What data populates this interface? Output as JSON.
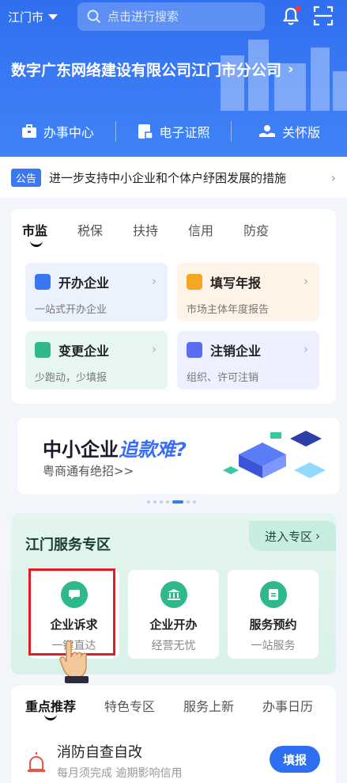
{
  "header": {
    "city": "江门市",
    "search_placeholder": "点击进行搜索",
    "company": "数字广东网络建设有限公司江门市分公司",
    "quick": [
      "办事中心",
      "电子证照",
      "关怀版"
    ]
  },
  "notice": {
    "tag": "公告",
    "text": "进一步支持中小企业和个体户纾困发展的措施"
  },
  "service": {
    "tabs": [
      "市监",
      "税保",
      "扶持",
      "信用",
      "防疫"
    ],
    "tiles": [
      {
        "title": "开办企业",
        "sub": "一站式开办企业"
      },
      {
        "title": "填写年报",
        "sub": "市场主体年度报告"
      },
      {
        "title": "变更企业",
        "sub": "少跑动，少填报"
      },
      {
        "title": "注销企业",
        "sub": "组织、许可注销"
      }
    ]
  },
  "banner": {
    "title_a": "中小企业",
    "title_b": "追款难?",
    "sub": "粤商通有绝招>>"
  },
  "zone": {
    "title": "江门服务专区",
    "enter": "进入专区",
    "tiles": [
      {
        "name": "企业诉求",
        "sub": "一键直达"
      },
      {
        "name": "企业开办",
        "sub": "经营无忧"
      },
      {
        "name": "服务预约",
        "sub": "一站服务"
      }
    ]
  },
  "bottom_tabs": [
    "重点推荐",
    "特色专区",
    "服务上新",
    "办事日历"
  ],
  "task": {
    "title": "消防自查自改",
    "sub": "每月须完成 逾期影响信用",
    "button": "填报"
  },
  "colors": {
    "primary": "#2f6ff0",
    "zone_green": "#2fb88a",
    "highlight_red": "#e41b23"
  }
}
